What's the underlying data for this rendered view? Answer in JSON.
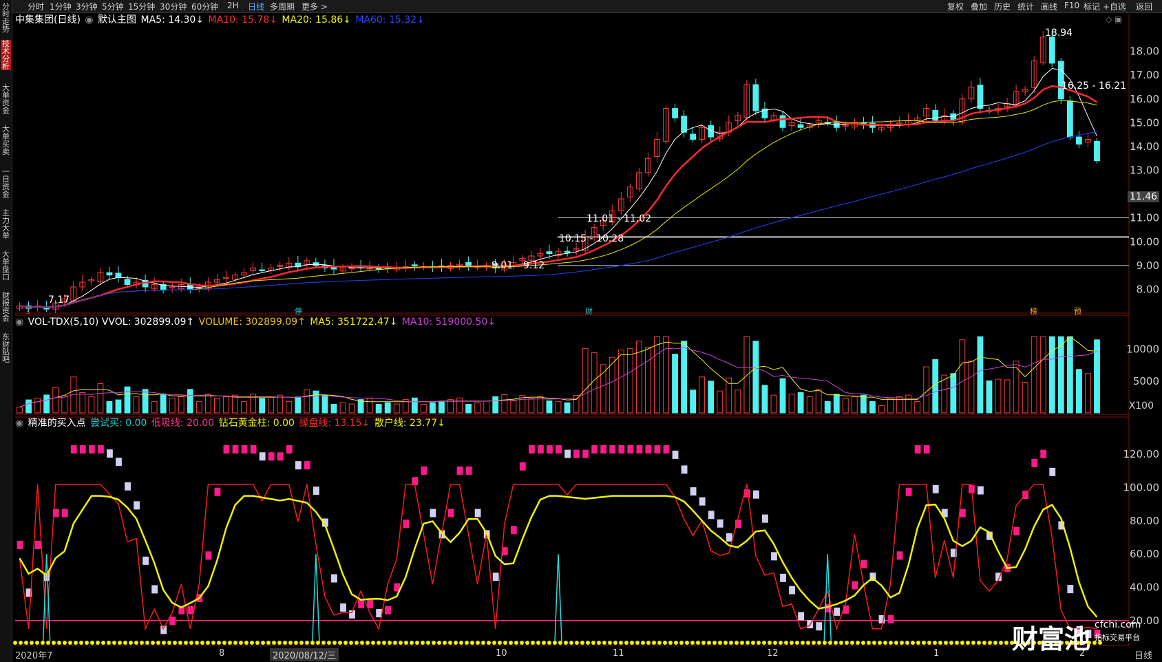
{
  "topbar": {
    "left_tabs": [
      "分时",
      "1分钟",
      "3分钟",
      "5分钟",
      "15分钟",
      "30分钟",
      "60分钟",
      "2H",
      "日线",
      "多周期",
      "更多 >"
    ],
    "active_tab": "日线",
    "right_tabs": [
      "复权",
      "叠加",
      "历史",
      "统计",
      "画线",
      "F10",
      "+自选",
      "返回"
    ],
    "mark_label": "标记"
  },
  "leftbar": {
    "items": [
      "分时走势",
      "技术分析",
      "大单资金",
      "大单买卖",
      "一日资金",
      "主力大单",
      "大单盘口",
      "财报资金",
      "东财贴吧"
    ],
    "active": "技术分析"
  },
  "main_legend": {
    "title": "中集集团(日线)",
    "chart_type": "默认主图",
    "ma5": "MA5: 14.30↓",
    "ma10": "MA10: 15.78↓",
    "ma20": "MA20: 15.86↓",
    "ma60": "MA60: 15.32↓"
  },
  "vol_legend": {
    "name": "VOL-TDX(5,10) VVOL: 302899.09↑",
    "volume": "VOLUME: 302899.09↑",
    "ma5": "MA5: 351722.47↓",
    "ma10": "MA10: 519000.50↓"
  },
  "ind_legend": {
    "name": "精准的买入点",
    "try_buy": "尝试买: 0.00",
    "low_suck": "低吸线: 20.00",
    "diamond": "钻石黄金柱: 0.00",
    "operate": "操盘线: 13.15↓",
    "retail": "散户线: 23.77↓"
  },
  "price_annotations": {
    "high": "18.94",
    "low": "7.17",
    "range1": "16.25 - 16.21",
    "range2": "11.01 - 11.02",
    "range3": "10.15 - 10.28",
    "p1": "9.01",
    "p2": "9.12",
    "last": "11.46"
  },
  "event_marks": {
    "s": "s",
    "ting": "停",
    "cai": "财",
    "bang": "榜",
    "yu": "预"
  },
  "vol_unit": "X100",
  "xaxis": {
    "labels": [
      "2020年7",
      "8",
      "2020/08/12/三",
      "10",
      "11",
      "12",
      "1",
      "2"
    ],
    "right_label": "日线"
  },
  "watermark": {
    "brand": "财富池",
    "site": "cfchi.com",
    "tag": "指标交易平台"
  },
  "chart_data": [
    {
      "type": "candlestick",
      "title": "中集集团(日线)",
      "yticks": [
        "18.00",
        "17.00",
        "16.00",
        "15.00",
        "14.00",
        "13.00",
        "11.00",
        "10.00",
        "9.00",
        "8.00"
      ],
      "ylim": [
        7.0,
        19.0
      ],
      "hlines": [
        11.01,
        10.2,
        9.0
      ],
      "series_ma_names": [
        "MA5",
        "MA10",
        "MA20",
        "MA60"
      ],
      "ma_colors": {
        "ma5": "#ffffff",
        "ma10": "#ff2a2a",
        "ma20": "#e8e800",
        "ma60": "#1b3bd8"
      },
      "close": [
        7.3,
        7.2,
        7.3,
        7.17,
        7.4,
        7.6,
        8.1,
        8.3,
        8.4,
        8.7,
        8.6,
        8.5,
        8.2,
        8.3,
        8.1,
        8.2,
        8.0,
        8.1,
        8.2,
        8.0,
        8.1,
        8.3,
        8.4,
        8.5,
        8.6,
        8.7,
        8.9,
        8.8,
        8.9,
        9.0,
        9.1,
        8.95,
        9.2,
        9.0,
        8.9,
        8.85,
        8.9,
        8.9,
        8.95,
        8.9,
        8.85,
        8.9,
        8.9,
        8.95,
        9.0,
        8.95,
        8.9,
        8.95,
        9.0,
        9.05,
        9.0,
        8.95,
        9.0,
        8.9,
        9.01,
        9.12,
        9.3,
        9.4,
        9.5,
        9.5,
        9.6,
        9.55,
        9.7,
        10.2,
        10.6,
        10.9,
        11.3,
        11.8,
        12.3,
        12.9,
        13.5,
        14.3,
        15.6,
        15.2,
        14.6,
        14.3,
        14.8,
        14.4,
        14.6,
        15.0,
        15.3,
        16.6,
        15.5,
        15.2,
        15.3,
        14.8,
        15.0,
        14.8,
        14.9,
        15.1,
        15.0,
        14.8,
        14.9,
        15.0,
        14.9,
        14.8,
        14.8,
        14.9,
        15.0,
        15.1,
        15.2,
        15.6,
        15.1,
        15.3,
        15.1,
        16.0,
        16.5,
        15.6,
        15.5,
        15.6,
        15.8,
        16.3,
        16.4,
        17.6,
        18.6,
        17.5,
        16.0,
        14.4,
        14.1,
        14.3,
        13.4
      ],
      "volume_unit": "X100",
      "volume_ticks": [
        "10000",
        "5000"
      ]
    },
    {
      "type": "line",
      "title": "精准的买入点",
      "yticks": [
        "120.00",
        "100.00",
        "80.00",
        "60.00",
        "40.00",
        "20.00"
      ],
      "ylim": [
        5,
        135
      ],
      "hline": 20.0,
      "series": [
        {
          "name": "操盘线",
          "color": "#ff1a1a"
        },
        {
          "name": "散户线",
          "color": "#f2f200"
        }
      ]
    }
  ]
}
